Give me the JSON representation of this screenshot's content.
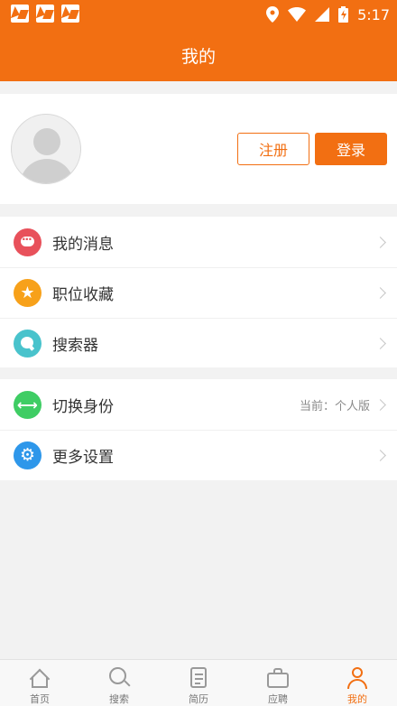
{
  "status_bar": {
    "time": "5:17",
    "icons": [
      "app-notification-icon",
      "app-notification-icon",
      "app-notification-icon",
      "location-icon",
      "wifi-icon",
      "battery-icon"
    ]
  },
  "header": {
    "title": "我的"
  },
  "profile": {
    "register_label": "注册",
    "login_label": "登录"
  },
  "menu_group_1": [
    {
      "label": "我的消息",
      "icon": "message-icon",
      "color": "#e8515b"
    },
    {
      "label": "职位收藏",
      "icon": "star-icon",
      "color": "#f7a11a"
    },
    {
      "label": "搜索器",
      "icon": "search-icon",
      "color": "#49c3cc"
    }
  ],
  "menu_group_2": [
    {
      "label": "切换身份",
      "value": "当前：个人版",
      "icon": "switch-icon",
      "color": "#3fcd64"
    },
    {
      "label": "更多设置",
      "icon": "settings-icon",
      "color": "#2e97ea"
    }
  ],
  "tabbar": {
    "items": [
      {
        "label": "首页",
        "icon": "home-icon"
      },
      {
        "label": "搜索",
        "icon": "search-icon"
      },
      {
        "label": "简历",
        "icon": "resume-icon"
      },
      {
        "label": "应聘",
        "icon": "briefcase-icon"
      },
      {
        "label": "我的",
        "icon": "user-icon",
        "active": true
      }
    ]
  },
  "colors": {
    "accent": "#f26f12",
    "background": "#f2f2f2"
  }
}
